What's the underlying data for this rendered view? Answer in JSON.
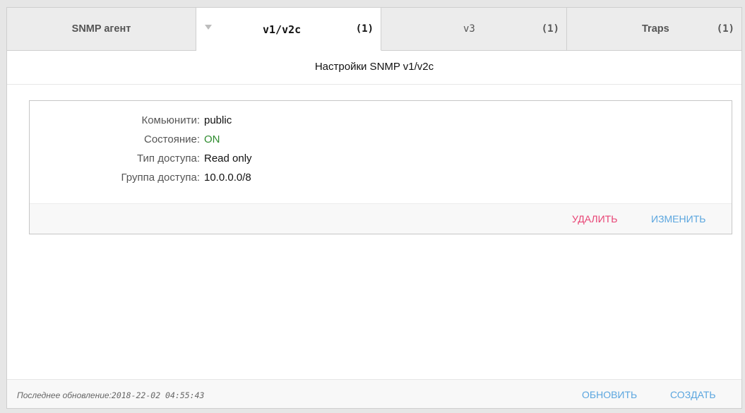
{
  "tabs": [
    {
      "label": "SNMP агент",
      "count": ""
    },
    {
      "label": "v1/v2c",
      "count": "(1)"
    },
    {
      "label": "v3",
      "count": "(1)"
    },
    {
      "label": "Traps",
      "count": "(1)"
    }
  ],
  "active_tab": "v1/v2c",
  "page_title": "Настройки SNMP v1/v2c",
  "community": {
    "fields": [
      {
        "label": "Комьюнити:",
        "value": "public"
      },
      {
        "label": "Состояние:",
        "value": "ON"
      },
      {
        "label": "Тип доступа:",
        "value": "Read only"
      },
      {
        "label": "Группа доступа:",
        "value": "10.0.0.0/8"
      }
    ],
    "delete_label": "УДАЛИТЬ",
    "edit_label": "ИЗМЕНИТЬ"
  },
  "footer": {
    "status_prefix": "Последнее обновление:",
    "timestamp": "2018-22-02 04:55:43",
    "refresh_label": "ОБНОВИТЬ",
    "create_label": "СОЗДАТЬ"
  },
  "icons": {
    "tab_dropdown": "chevron-down-icon"
  },
  "colors": {
    "on_status": "#2e8b2e",
    "delete": "#e84374",
    "link": "#5ba6df"
  }
}
